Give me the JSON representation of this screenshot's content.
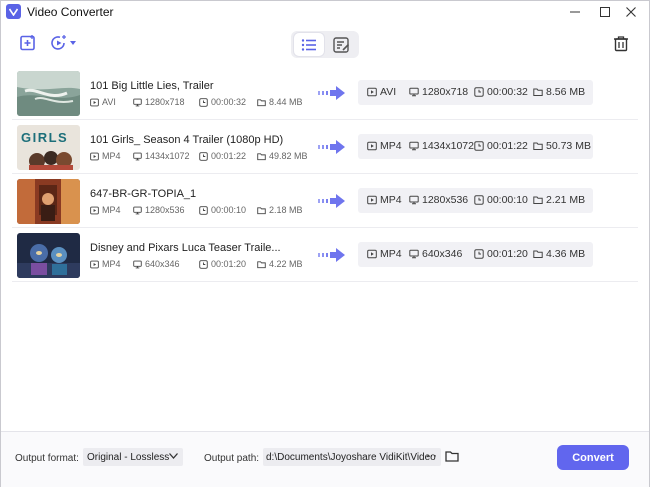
{
  "app": {
    "title": "Video Converter"
  },
  "colors": {
    "accent": "#6166ee",
    "arrow": "#7a80f0"
  },
  "files": [
    {
      "name": "101 Big Little Lies, Trailer",
      "src": {
        "format": "AVI",
        "resolution": "1280x718",
        "duration": "00:00:32",
        "size": "8.44 MB"
      },
      "out": {
        "format": "AVI",
        "resolution": "1280x718",
        "duration": "00:00:32",
        "size": "8.56 MB"
      }
    },
    {
      "name": "101 Girls_ Season 4 Trailer (1080p HD)",
      "thumb_text": "GIRLS",
      "src": {
        "format": "MP4",
        "resolution": "1434x1072",
        "duration": "00:01:22",
        "size": "49.82 MB"
      },
      "out": {
        "format": "MP4",
        "resolution": "1434x1072",
        "duration": "00:01:22",
        "size": "50.73 MB"
      }
    },
    {
      "name": "647-BR-GR-TOPIA_1",
      "src": {
        "format": "MP4",
        "resolution": "1280x536",
        "duration": "00:00:10",
        "size": "2.18 MB"
      },
      "out": {
        "format": "MP4",
        "resolution": "1280x536",
        "duration": "00:00:10",
        "size": "2.21 MB"
      }
    },
    {
      "name": "Disney and Pixars Luca  Teaser Traile...",
      "src": {
        "format": "MP4",
        "resolution": "640x346",
        "duration": "00:01:20",
        "size": "4.22 MB"
      },
      "out": {
        "format": "MP4",
        "resolution": "640x346",
        "duration": "00:01:20",
        "size": "4.36 MB"
      }
    }
  ],
  "bottom": {
    "output_format_label": "Output format:",
    "output_format_value": "Original - Lossless",
    "output_path_label": "Output path:",
    "output_path_value": "d:\\Documents\\Joyoshare VidiKit\\Video",
    "path_more": "···",
    "convert_label": "Convert"
  }
}
